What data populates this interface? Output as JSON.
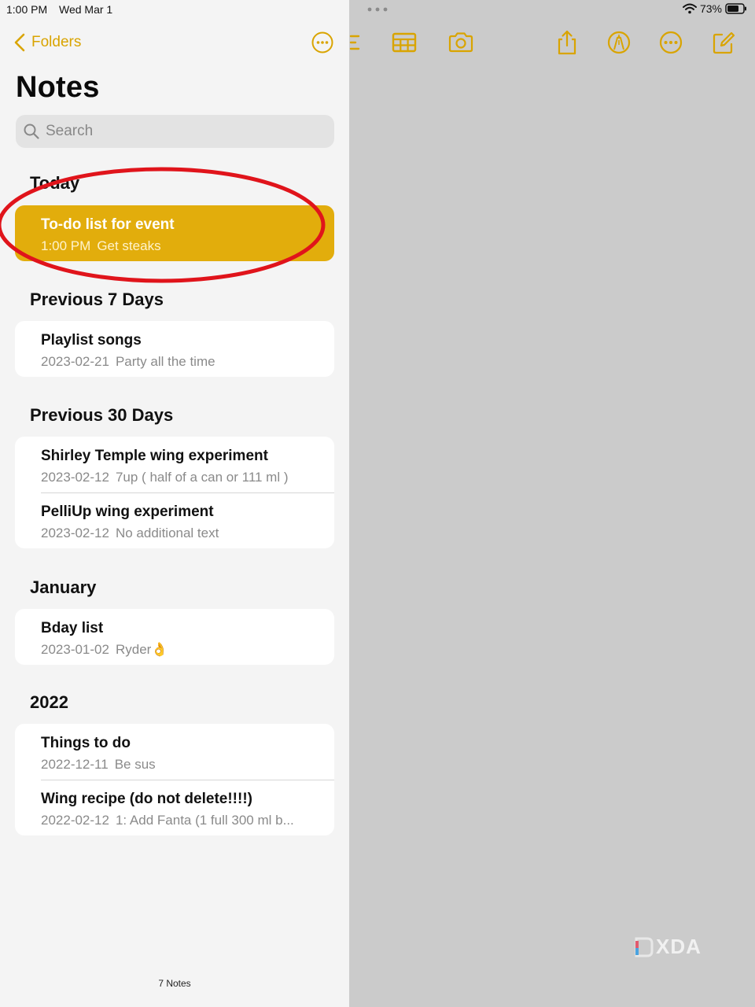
{
  "status": {
    "time": "1:00 PM",
    "date": "Wed Mar 1",
    "battery": "73%"
  },
  "nav": {
    "back_label": "Folders"
  },
  "page": {
    "title": "Notes"
  },
  "search": {
    "placeholder": "Search"
  },
  "sections": [
    {
      "title": "Today",
      "notes": [
        {
          "title": "To-do list for event",
          "date": "1:00 PM",
          "preview": "Get steaks"
        }
      ]
    },
    {
      "title": "Previous 7 Days",
      "notes": [
        {
          "title": "Playlist songs",
          "date": "2023-02-21",
          "preview": "Party all the time"
        }
      ]
    },
    {
      "title": "Previous 30 Days",
      "notes": [
        {
          "title": "Shirley Temple wing experiment",
          "date": "2023-02-12",
          "preview": "7up ( half of a can or 111 ml )"
        },
        {
          "title": "PelliUp wing experiment",
          "date": "2023-02-12",
          "preview": "No additional text"
        }
      ]
    },
    {
      "title": "January",
      "notes": [
        {
          "title": "Bday list",
          "date": "2023-01-02",
          "preview": "Ryder👌"
        }
      ]
    },
    {
      "title": "2022",
      "notes": [
        {
          "title": "Things to do",
          "date": "2022-12-11",
          "preview": "Be sus"
        },
        {
          "title": "Wing recipe (do not delete!!!!)",
          "date": "2022-02-12",
          "preview": "1: Add Fanta (1 full 300 ml b..."
        }
      ]
    }
  ],
  "footer": {
    "count": "7 Notes"
  },
  "watermark": {
    "text": "XDA"
  },
  "colors": {
    "accent": "#d9a400",
    "selected": "#e2ad0c",
    "sidebar_bg": "#f4f4f4",
    "pane_bg": "#cbcbcb",
    "annotation": "#e0141b"
  },
  "icons": {
    "back": "chevron-left-icon",
    "more": "ellipsis-circle-icon",
    "search": "magnifier-icon",
    "checklist": "checklist-icon",
    "table": "table-icon",
    "camera": "camera-icon",
    "share": "share-icon",
    "markup": "markup-pen-icon",
    "compose": "compose-icon",
    "wifi": "wifi-icon",
    "battery": "battery-icon"
  }
}
